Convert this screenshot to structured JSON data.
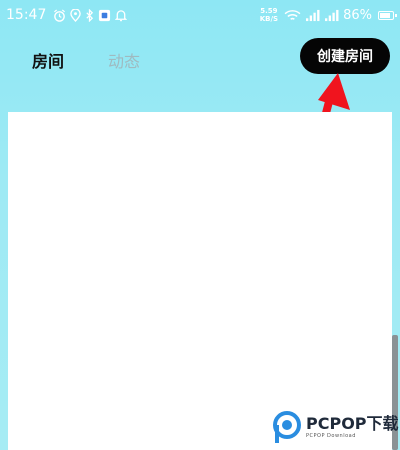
{
  "status_bar": {
    "time": "15:47",
    "left_icons": [
      "alarm-icon",
      "location-icon",
      "bluetooth-icon",
      "app-notification-icon",
      "bell-icon"
    ],
    "net_speed_value": "5.59",
    "net_speed_unit": "KB/S",
    "battery": "86%",
    "battery_level_percent": 86
  },
  "header": {
    "tabs": [
      {
        "label": "房间",
        "active": true
      },
      {
        "label": "动态",
        "active": false
      }
    ],
    "create_room_label": "创建房间"
  },
  "watermark": {
    "brand": "PCPOP下载",
    "sub": "PCPOP Download"
  },
  "colors": {
    "background": "#9ee9f4",
    "button_bg": "#050505",
    "arrow": "#f0141e",
    "inactive_tab": "#9fbac0"
  }
}
